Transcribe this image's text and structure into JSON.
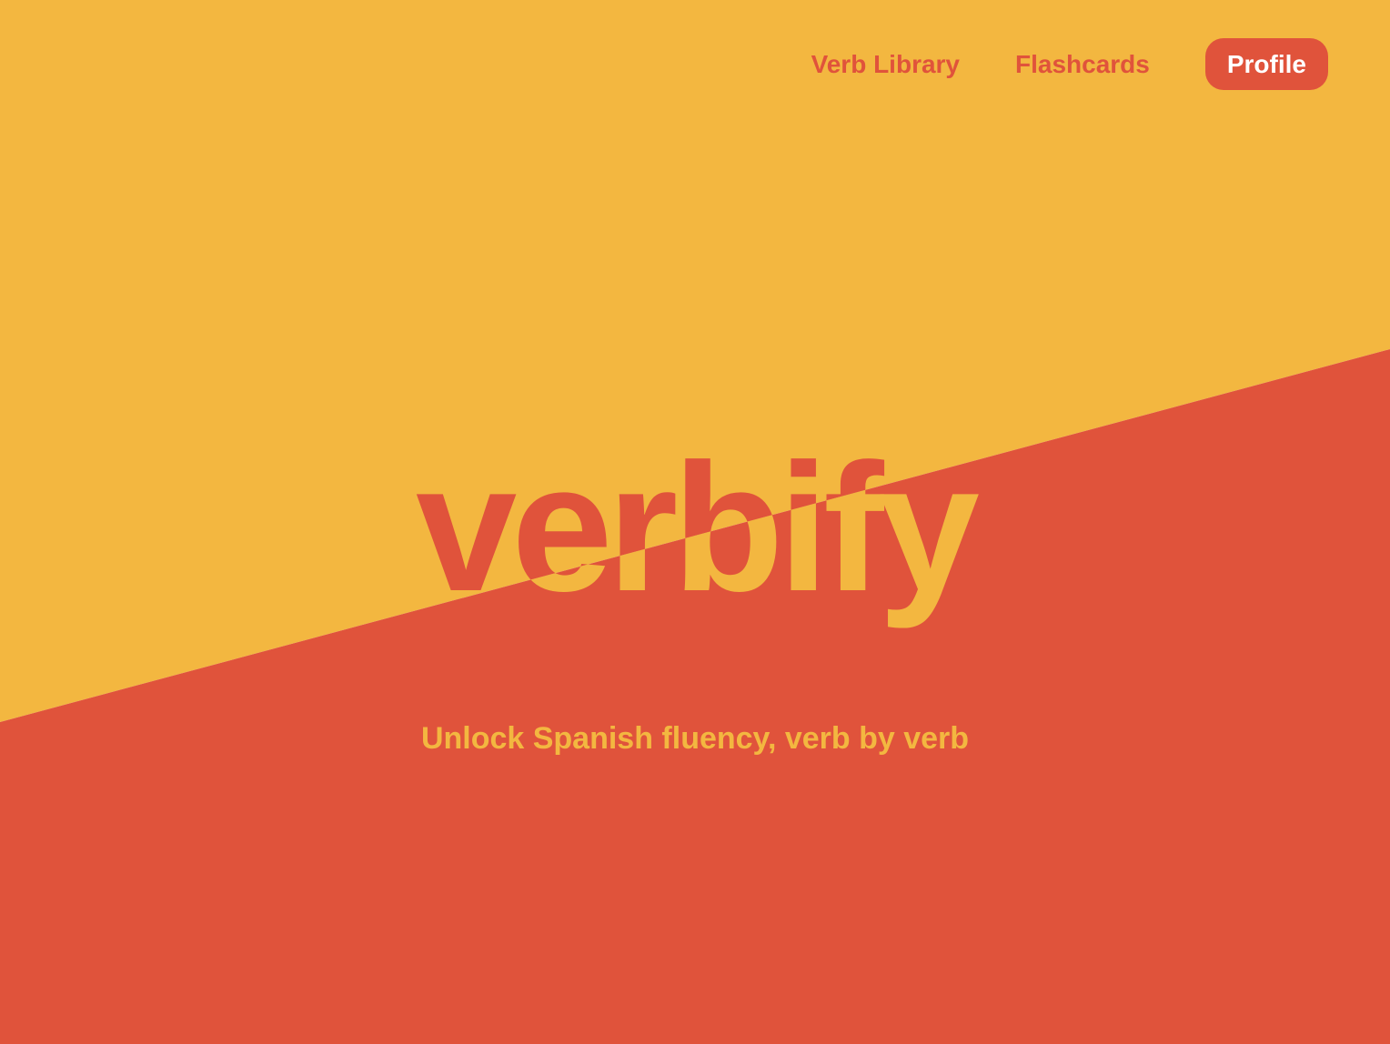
{
  "brand": {
    "wordmark": "verbify",
    "tagline": "Unlock Spanish fluency, verb by verb"
  },
  "nav": {
    "links": [
      {
        "label": "Verb Library"
      },
      {
        "label": "Flashcards"
      }
    ],
    "profile_label": "Profile"
  },
  "colors": {
    "yellow": "#f3b740",
    "red": "#e0533b",
    "white": "#ffffff"
  }
}
